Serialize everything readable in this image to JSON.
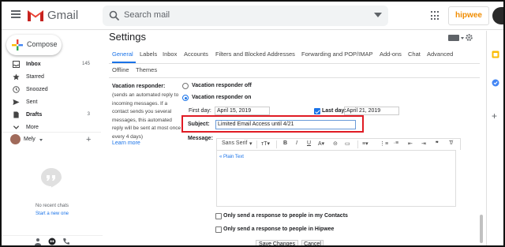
{
  "topbar": {
    "app_name": "Gmail",
    "search_placeholder": "Search mail",
    "account_logo": "hipwee"
  },
  "nav": {
    "compose_label": "Compose",
    "items": [
      {
        "label": "Inbox",
        "count": "145",
        "icon": "inbox-icon",
        "bold": true
      },
      {
        "label": "Starred",
        "count": "",
        "icon": "star-icon",
        "bold": false
      },
      {
        "label": "Snoozed",
        "count": "",
        "icon": "clock-icon",
        "bold": false
      },
      {
        "label": "Sent",
        "count": "",
        "icon": "send-icon",
        "bold": false
      },
      {
        "label": "Drafts",
        "count": "3",
        "icon": "draft-icon",
        "bold": true
      },
      {
        "label": "More",
        "count": "",
        "icon": "chevron-down-icon",
        "bold": false
      }
    ],
    "user_name": "Mely",
    "no_chats": "No recent chats",
    "start_new": "Start a new one"
  },
  "settings": {
    "title": "Settings",
    "tabs": [
      "General",
      "Labels",
      "Inbox",
      "Accounts",
      "Filters and Blocked Addresses",
      "Forwarding and POP/IMAP",
      "Add-ons",
      "Chat",
      "Advanced"
    ],
    "tabs_row2": [
      "Offline",
      "Themes"
    ],
    "active_tab": "General"
  },
  "vacation": {
    "title": "Vacation responder:",
    "desc": "(sends an automated reply to incoming messages. If a contact sends you several messages, this automated reply will be sent at most once every 4 days)",
    "learn_more": "Learn more",
    "off_label": "Vacation responder off",
    "on_label": "Vacation responder on",
    "selected": "on",
    "first_day_label": "First day:",
    "first_day_value": "April 15, 2019",
    "last_day_label": "Last day:",
    "last_day_value": "April 21, 2019",
    "last_day_checked": true,
    "subject_label": "Subject:",
    "subject_value": "Limited Email Access until 4/21",
    "message_label": "Message:",
    "font_name": "Sans Serif",
    "plain_text_link": "« Plain Text",
    "contacts_only_label": "Only send a response to people in my Contacts",
    "org_only_label": "Only send a response to people in Hipwee",
    "contacts_only_checked": false,
    "org_only_checked": false
  },
  "buttons": {
    "save": "Save Changes",
    "cancel": "Cancel"
  },
  "colors": {
    "accent": "#1a73e8",
    "highlight": "#e01b24",
    "gmail_red": "#ea4335",
    "hipwee_orange": "#f08c00"
  }
}
